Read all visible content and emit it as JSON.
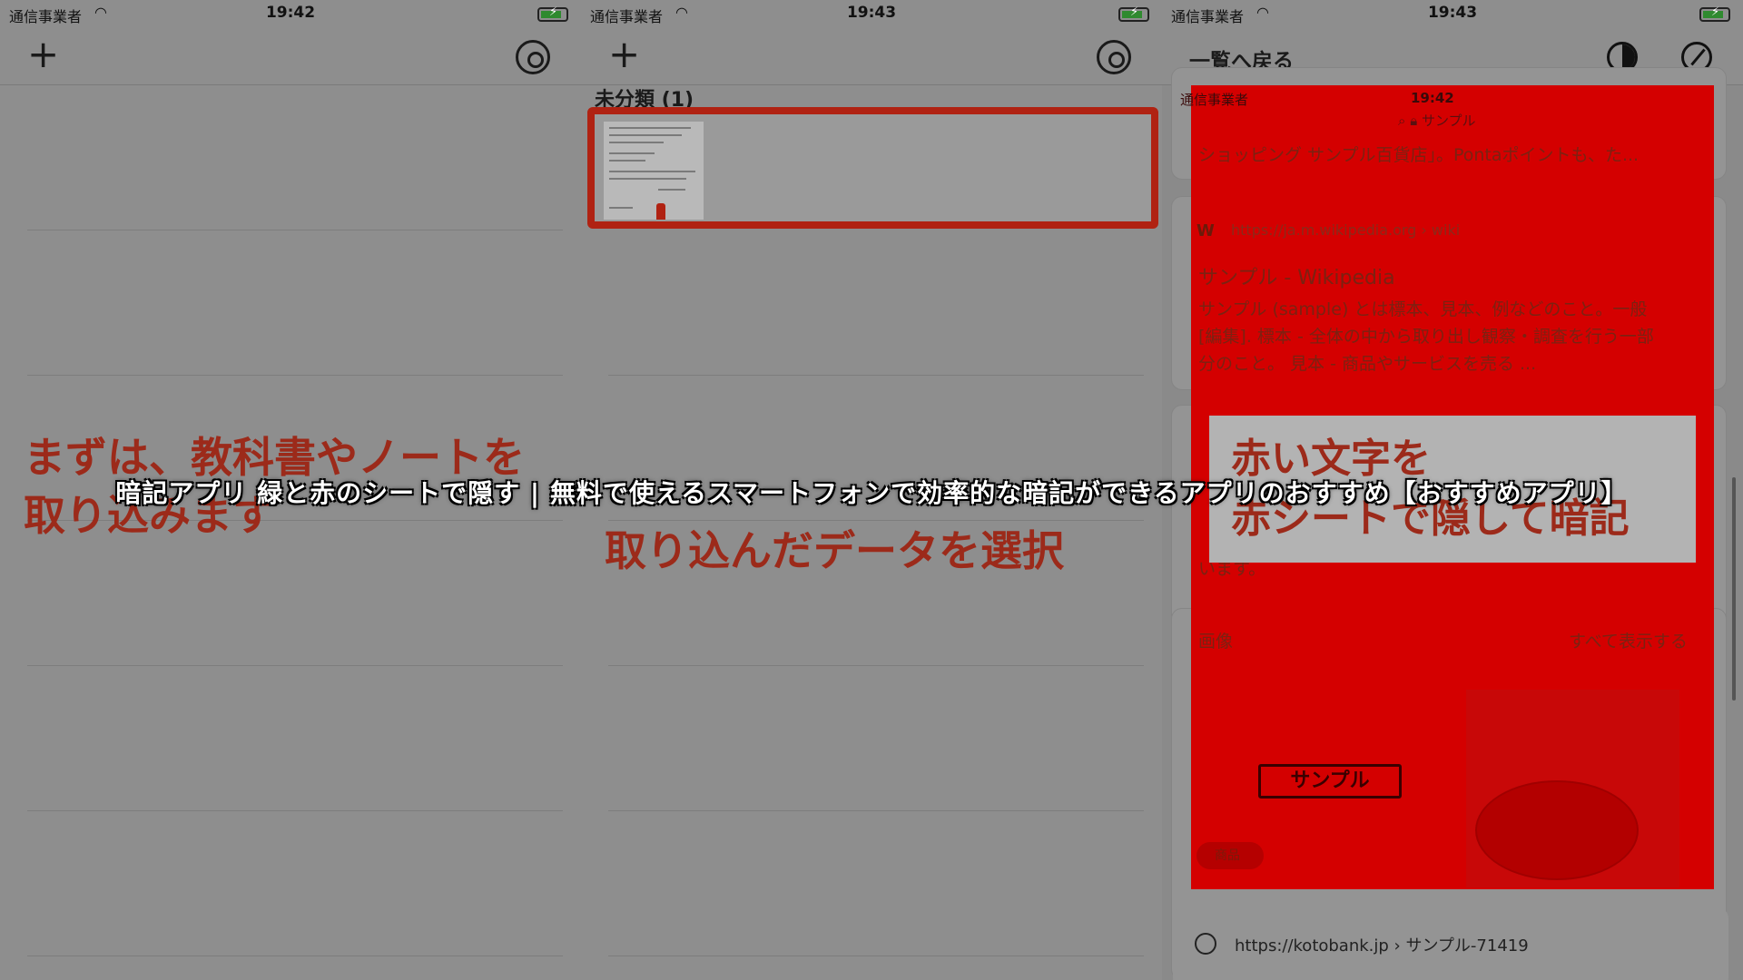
{
  "panels": [
    {
      "status": {
        "carrier": "通信事業者",
        "time": "19:42"
      }
    },
    {
      "status": {
        "carrier": "通信事業者",
        "time": "19:43"
      },
      "section_header": "未分類 (1)"
    },
    {
      "status": {
        "carrier": "通信事業者",
        "time": "19:43"
      },
      "back_label": "一覧へ戻る"
    }
  ],
  "instructions": {
    "step1_line1": "まずは、教科書やノートを",
    "step1_line2": "取り込みます",
    "step2": "取り込んだデータを選択",
    "step3_line1": "赤い文字を",
    "step3_line2": "赤シートで隠して暗記"
  },
  "preview": {
    "status_carrier": "通信事業者",
    "status_time": "19:42",
    "search_query": "サンプル",
    "snippet_top": "ショッピング サンプル百貨店」。Pontaポイントも、た...",
    "wiki_url": "https://ja.m.wikipedia.org › wiki",
    "wiki_title": "サンプル - Wikipedia",
    "wiki_text_1": "サンプル (sample) とは標本、見本、例などのこと。一般",
    "wiki_text_2": "[編集]. 標本 - 全体の中から取り出し観察・調査を行う一部",
    "wiki_text_3": "分のこと。 見本 - 商品やサービスを売る ...",
    "partial_text": "います。",
    "images_label": "画像",
    "show_all": "すべて表示する",
    "sample_button": "サンプル",
    "tag_label": "商品"
  },
  "kotobank": {
    "url": "https://kotobank.jp › サンプル-71419"
  },
  "caption": "暗記アプリ 緑と赤のシートで隠す | 無料で使えるスマートフォンで効率的な暗記ができるアプリのおすすめ【おすすめアプリ】",
  "colors": {
    "red_sheet": "#d40000",
    "instruction_text": "#9c2a1a",
    "thumbnail_border": "#b02212"
  },
  "icons": [
    "plus-icon",
    "gear-icon",
    "wifi-icon",
    "battery-icon",
    "contrast-icon",
    "edit-icon",
    "search-icon",
    "lock-icon"
  ]
}
